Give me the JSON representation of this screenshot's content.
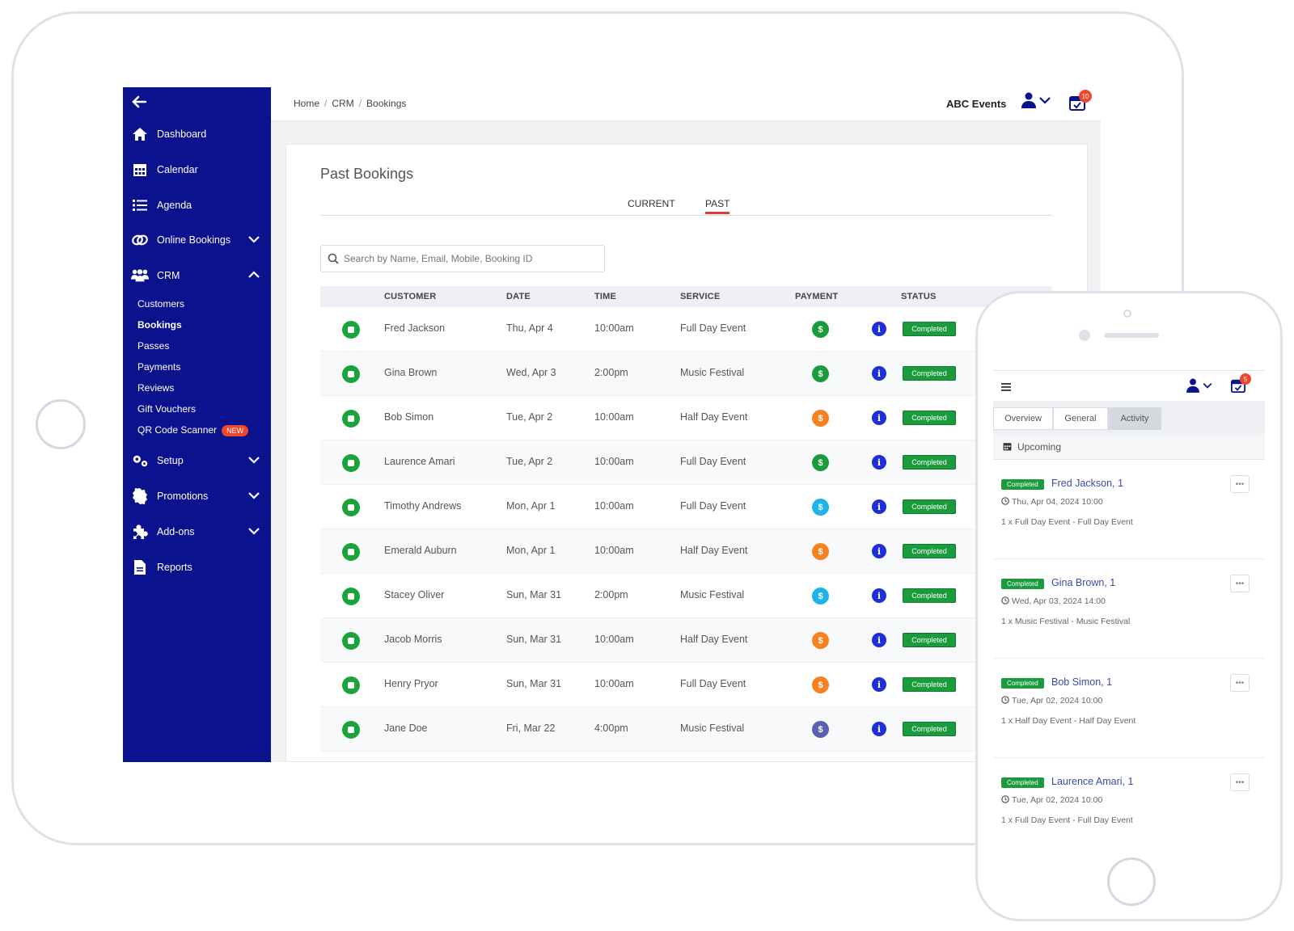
{
  "sidebar": {
    "items": [
      {
        "label": "Dashboard",
        "icon": "home-icon"
      },
      {
        "label": "Calendar",
        "icon": "calendar-icon"
      },
      {
        "label": "Agenda",
        "icon": "list-icon"
      },
      {
        "label": "Online Bookings",
        "icon": "link-icon"
      },
      {
        "label": "CRM",
        "icon": "users-icon"
      },
      {
        "label": "Setup",
        "icon": "gears-icon"
      },
      {
        "label": "Promotions",
        "icon": "badge-icon"
      },
      {
        "label": "Add-ons",
        "icon": "puzzle-icon"
      },
      {
        "label": "Reports",
        "icon": "document-icon"
      }
    ],
    "crm_sub": [
      "Customers",
      "Bookings",
      "Passes",
      "Payments",
      "Reviews",
      "Gift Vouchers",
      "QR Code Scanner"
    ],
    "new_badge": "NEW"
  },
  "header": {
    "breadcrumb": [
      "Home",
      "CRM",
      "Bookings"
    ],
    "org_name": "ABC Events",
    "notification_count": "10"
  },
  "page": {
    "title": "Past Bookings",
    "tabs": [
      "CURRENT",
      "PAST"
    ],
    "active_tab": "PAST",
    "search_placeholder": "Search by Name, Email, Mobile, Booking ID"
  },
  "table": {
    "columns": [
      "CUSTOMER",
      "DATE",
      "TIME",
      "SERVICE",
      "PAYMENT",
      "STATUS"
    ],
    "rows": [
      {
        "customer": "Fred Jackson",
        "date": "Thu, Apr 4",
        "time": "10:00am",
        "service": "Full Day Event",
        "payment_color": "#1a9b3c",
        "status": "Completed"
      },
      {
        "customer": "Gina Brown",
        "date": "Wed, Apr 3",
        "time": "2:00pm",
        "service": "Music Festival",
        "payment_color": "#1a9b3c",
        "status": "Completed"
      },
      {
        "customer": "Bob Simon",
        "date": "Tue, Apr 2",
        "time": "10:00am",
        "service": "Half Day Event",
        "payment_color": "#f5821f",
        "status": "Completed"
      },
      {
        "customer": "Laurence Amari",
        "date": "Tue, Apr 2",
        "time": "10:00am",
        "service": "Full Day Event",
        "payment_color": "#1a9b3c",
        "status": "Completed"
      },
      {
        "customer": "Timothy Andrews",
        "date": "Mon, Apr 1",
        "time": "10:00am",
        "service": "Full Day Event",
        "payment_color": "#1db4ea",
        "status": "Completed"
      },
      {
        "customer": "Emerald Auburn",
        "date": "Mon, Apr 1",
        "time": "10:00am",
        "service": "Half Day Event",
        "payment_color": "#f5821f",
        "status": "Completed"
      },
      {
        "customer": "Stacey Oliver",
        "date": "Sun, Mar 31",
        "time": "2:00pm",
        "service": "Music Festival",
        "payment_color": "#1db4ea",
        "status": "Completed"
      },
      {
        "customer": "Jacob Morris",
        "date": "Sun, Mar 31",
        "time": "10:00am",
        "service": "Half Day Event",
        "payment_color": "#f5821f",
        "status": "Completed"
      },
      {
        "customer": "Henry Pryor",
        "date": "Sun, Mar 31",
        "time": "10:00am",
        "service": "Full Day Event",
        "payment_color": "#f5821f",
        "status": "Completed"
      },
      {
        "customer": "Jane Doe",
        "date": "Fri, Mar 22",
        "time": "4:00pm",
        "service": "Music Festival",
        "payment_color": "#5c5fb0",
        "status": "Completed"
      }
    ],
    "payment_symbol": "$",
    "info_symbol": "i"
  },
  "phone": {
    "notification_count": "5",
    "tabs": [
      "Overview",
      "General",
      "Activity"
    ],
    "active_tab": "Activity",
    "section": "Upcoming",
    "items": [
      {
        "status": "Completed",
        "name": "Fred Jackson, 1",
        "date": "Thu, Apr 04, 2024 10:00",
        "desc": "1 x Full Day Event - Full Day Event"
      },
      {
        "status": "Completed",
        "name": "Gina Brown, 1",
        "date": "Wed, Apr 03, 2024 14:00",
        "desc": "1 x Music Festival - Music Festival"
      },
      {
        "status": "Completed",
        "name": "Bob Simon, 1",
        "date": "Tue, Apr 02, 2024 10:00",
        "desc": "1 x Half Day Event - Half Day Event"
      },
      {
        "status": "Completed",
        "name": "Laurence Amari, 1",
        "date": "Tue, Apr 02, 2024 10:00",
        "desc": "1 x Full Day Event - Full Day Event"
      }
    ],
    "more_symbol": "•••"
  }
}
